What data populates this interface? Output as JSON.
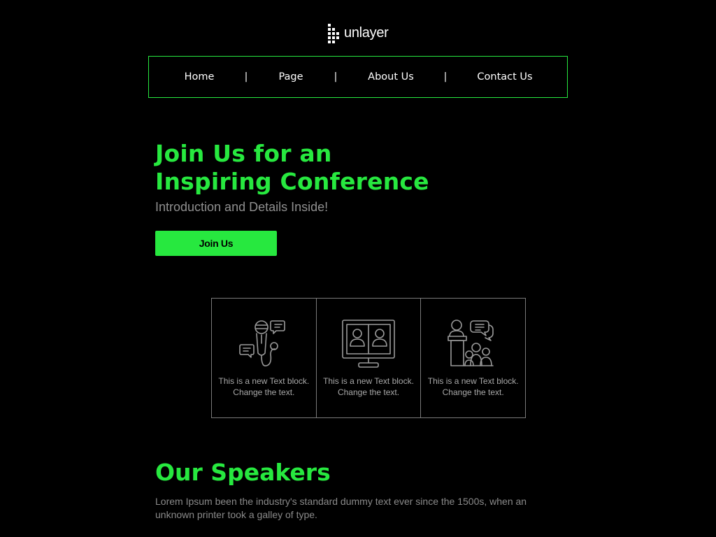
{
  "logo": {
    "text": "unlayer",
    "icon": "unlayer-logo-icon"
  },
  "nav": {
    "items": [
      "Home",
      "Page",
      "About Us",
      "Contact Us"
    ],
    "separator": "|"
  },
  "hero": {
    "title": "Join Us for an Inspiring Conference",
    "subtitle": "Introduction and Details Inside!",
    "button_label": "Join Us"
  },
  "features": [
    {
      "icon": "microphone-chat-icon",
      "text": "This is a new Text block. Change the text."
    },
    {
      "icon": "video-conference-icon",
      "text": "This is a new Text block. Change the text."
    },
    {
      "icon": "speaker-audience-icon",
      "text": "This is a new Text block. Change the text."
    }
  ],
  "speakers": {
    "title": "Our Speakers",
    "text": "Lorem Ipsum been the industry's standard dummy text ever since the 1500s, when an unknown printer took a galley of type."
  },
  "colors": {
    "background": "#000000",
    "accent": "#27e83f",
    "border": "#7a7a7a",
    "muted_text": "#8f8f8f"
  }
}
